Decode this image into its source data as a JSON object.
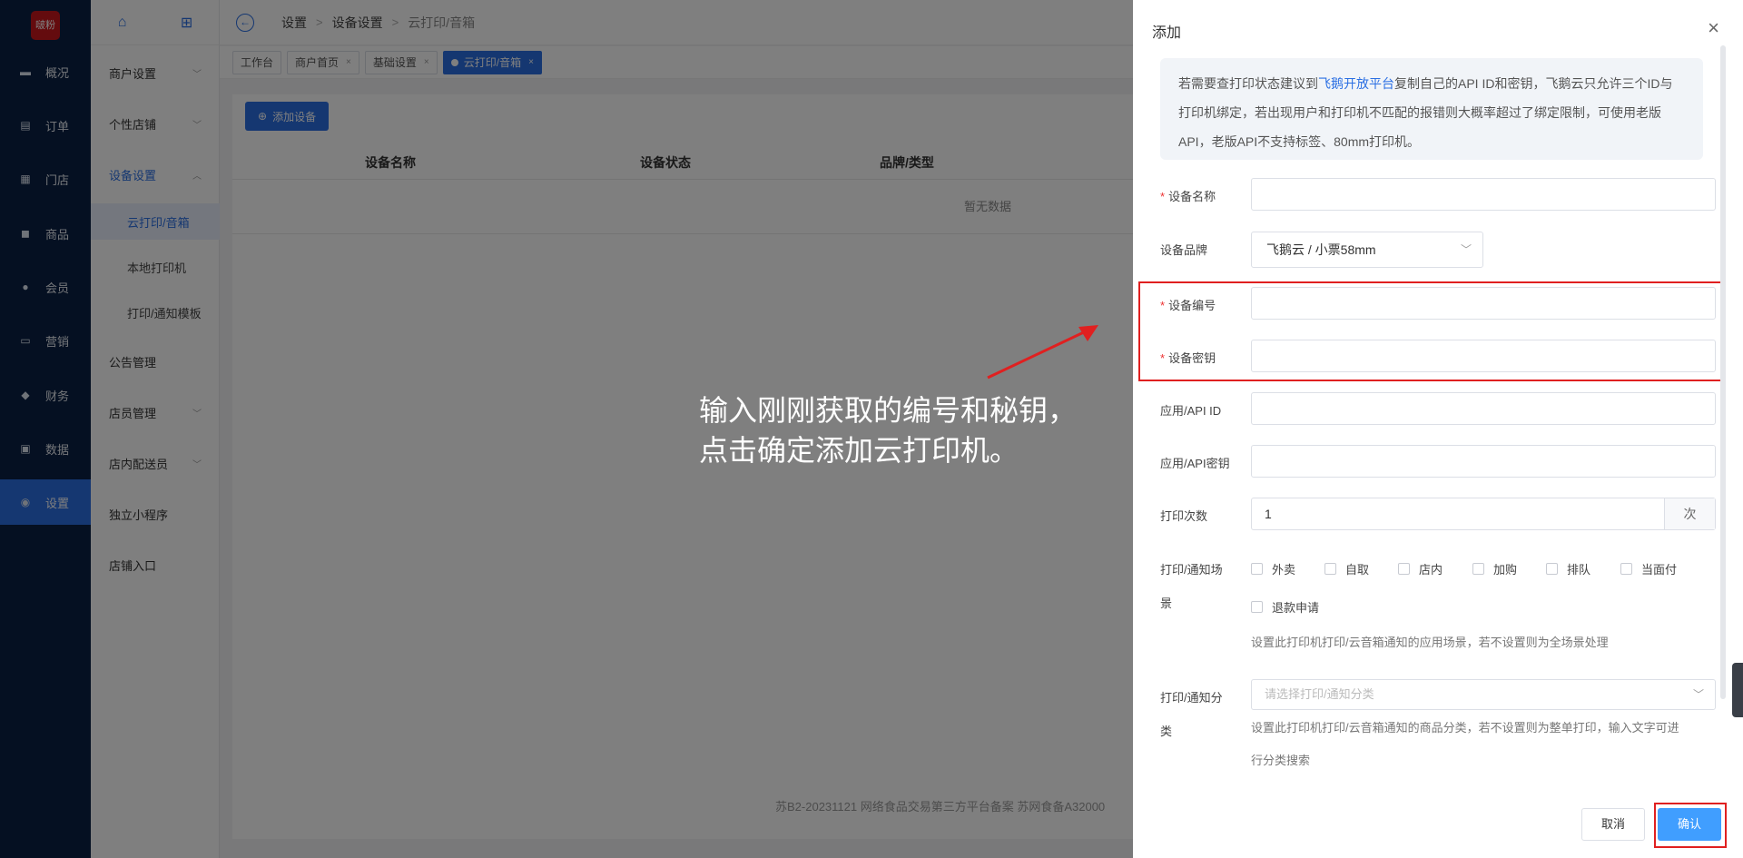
{
  "logo": {
    "text": "啵粉"
  },
  "leftnav": [
    {
      "label": "概况",
      "icon": "overview-icon",
      "glyph": "▬"
    },
    {
      "label": "订单",
      "icon": "order-icon",
      "glyph": "▤"
    },
    {
      "label": "门店",
      "icon": "store-icon",
      "glyph": "▦"
    },
    {
      "label": "商品",
      "icon": "goods-icon",
      "glyph": "◼"
    },
    {
      "label": "会员",
      "icon": "member-icon",
      "glyph": "●"
    },
    {
      "label": "营销",
      "icon": "marketing-icon",
      "glyph": "▭"
    },
    {
      "label": "财务",
      "icon": "finance-icon",
      "glyph": "◆"
    },
    {
      "label": "数据",
      "icon": "data-icon",
      "glyph": "▣"
    },
    {
      "label": "设置",
      "icon": "settings-icon",
      "glyph": "◉"
    }
  ],
  "submenu": {
    "home_glyph": "⌂",
    "grid_glyph": "⊞",
    "items": [
      "商户设置",
      "个性店铺",
      "设备设置",
      "云打印/音箱",
      "本地打印机",
      "打印/通知模板",
      "公告管理",
      "店员管理",
      "店内配送员",
      "独立小程序",
      "店铺入口"
    ]
  },
  "breadcrumb": {
    "back_glyph": "←",
    "sep": ">",
    "items": [
      "设置",
      "设备设置",
      "云打印/音箱"
    ]
  },
  "tabs": [
    "工作台",
    "商户首页",
    "基础设置",
    "云打印/音箱"
  ],
  "tab_close": "×",
  "content": {
    "add_button": "添加设备",
    "add_glyph": "⊕",
    "columns": [
      "设备名称",
      "设备状态",
      "品牌/类型"
    ],
    "empty_text": "暂无数据",
    "footer": "苏B2-20231121  网络食品交易第三方平台备案 苏网食备A32000"
  },
  "annotation": {
    "line1": "输入刚刚获取的编号和秘钥，",
    "line2": "点击确定添加云打印机。"
  },
  "drawer": {
    "title": "添加",
    "close_glyph": "×",
    "notice_before": "若需要查打印状态建议到",
    "notice_link": "飞鹅开放平台",
    "notice_after": "复制自己的API ID和密钥，飞鹅云只允许三个ID与打印机绑定，若出现用户和打印机不匹配的报错则大概率超过了绑定限制，可使用老版API，老版API不支持标签、80mm打印机。",
    "required_mark": "*",
    "fields": {
      "device_name": {
        "label": "设备名称",
        "value": ""
      },
      "brand": {
        "label": "设备品牌",
        "value": "飞鹅云 / 小票58mm"
      },
      "device_no": {
        "label": "设备编号",
        "value": ""
      },
      "device_key": {
        "label": "设备密钥",
        "value": ""
      },
      "api_id": {
        "label": "应用/API ID",
        "value": ""
      },
      "api_key": {
        "label": "应用/API密钥",
        "value": ""
      },
      "print_times": {
        "label": "打印次数",
        "value": "1",
        "suffix": "次"
      }
    },
    "scene": {
      "label1": "打印/通知场",
      "label2": "景",
      "options": [
        "外卖",
        "自取",
        "店内",
        "加购",
        "排队",
        "当面付",
        "退款申请"
      ],
      "hint": "设置此打印机打印/云音箱通知的应用场景，若不设置则为全场景处理"
    },
    "category": {
      "label1": "打印/通知分",
      "label2": "类",
      "placeholder": "请选择打印/通知分类",
      "hint1": "设置此打印机打印/云音箱通知的商品分类，若不设置则为整单打印，输入文字可进",
      "hint2": "行分类搜索"
    },
    "chevron_glyph": "﹀",
    "cancel": "取消",
    "confirm": "确认"
  }
}
